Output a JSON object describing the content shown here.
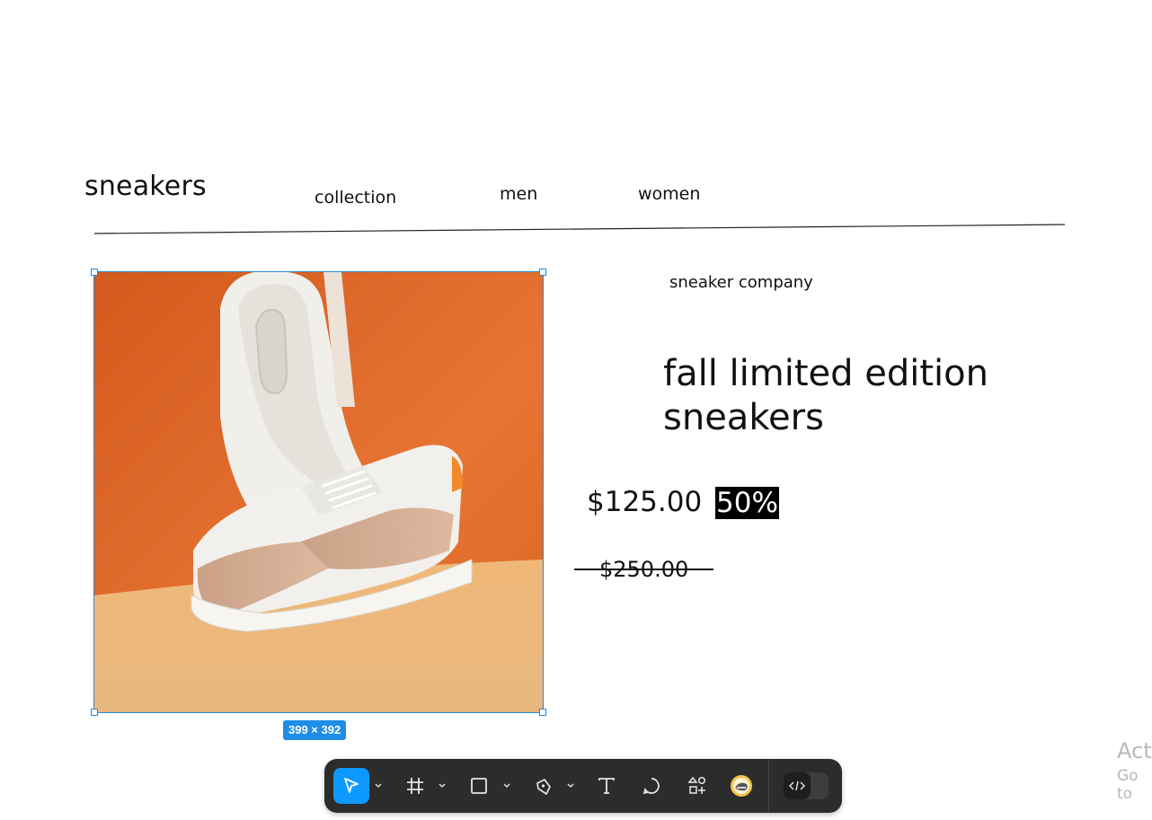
{
  "header": {
    "brand": "sneakers",
    "nav": [
      {
        "label": "collection"
      },
      {
        "label": "men"
      },
      {
        "label": "women"
      }
    ]
  },
  "canvas": {
    "selection_size": "399 × 392"
  },
  "product": {
    "company": "sneaker company",
    "title_line1": "fall limited edition",
    "title_line2": "sneakers",
    "price": "$125.00",
    "discount": "50%",
    "original_price": "$250.00"
  },
  "toolbar": {
    "tools": [
      {
        "icon": "move-icon",
        "active": true
      },
      {
        "icon": "frame-icon"
      },
      {
        "icon": "rectangle-icon"
      },
      {
        "icon": "pen-icon"
      },
      {
        "icon": "text-icon"
      },
      {
        "icon": "comment-icon"
      },
      {
        "icon": "actions-icon"
      },
      {
        "icon": "ai-icon"
      },
      {
        "icon": "dev-mode-icon"
      }
    ]
  },
  "watermark": {
    "line1": "Acti",
    "line2": "Go to"
  },
  "colors": {
    "selection": "#1e8de8",
    "toolbar_bg": "#2c2c2c",
    "tool_active": "#0d99ff",
    "shoe_bg_orange": "#e06a28",
    "shoe_floor": "#e8b87c"
  }
}
